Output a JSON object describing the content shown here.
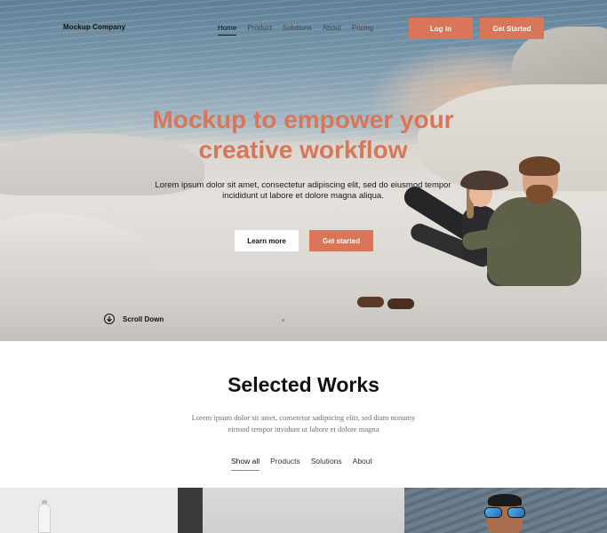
{
  "header": {
    "brand": "Mockup Company",
    "nav": [
      "Home",
      "Product",
      "Solutions",
      "About",
      "Pricing"
    ],
    "login_label": "Log in",
    "get_started_label": "Get Started"
  },
  "hero": {
    "title": "Mockup to empower your creative workflow",
    "subtitle": "Lorem ipsum dolor sit amet, consectetur adipiscing elit, sed do eiusmod tempor incididunt ut labore et dolore magna aliqua.",
    "learn_more_label": "Learn more",
    "get_started_label": "Get started",
    "scroll_label": "Scroll Down"
  },
  "works": {
    "title": "Selected Works",
    "subtitle": "Lorem ipsum dolor sit amet, consetetur sadipscing elitr, sed diam nonumy eirmod tempor invidunt ut labore et dolore magna",
    "filters": [
      "Show all",
      "Products",
      "Solutions",
      "About"
    ]
  },
  "colors": {
    "accent": "#d97558",
    "text": "#111111",
    "muted": "#6f6f6f"
  },
  "icons": {
    "scroll": "arrow-down-circle-icon"
  }
}
